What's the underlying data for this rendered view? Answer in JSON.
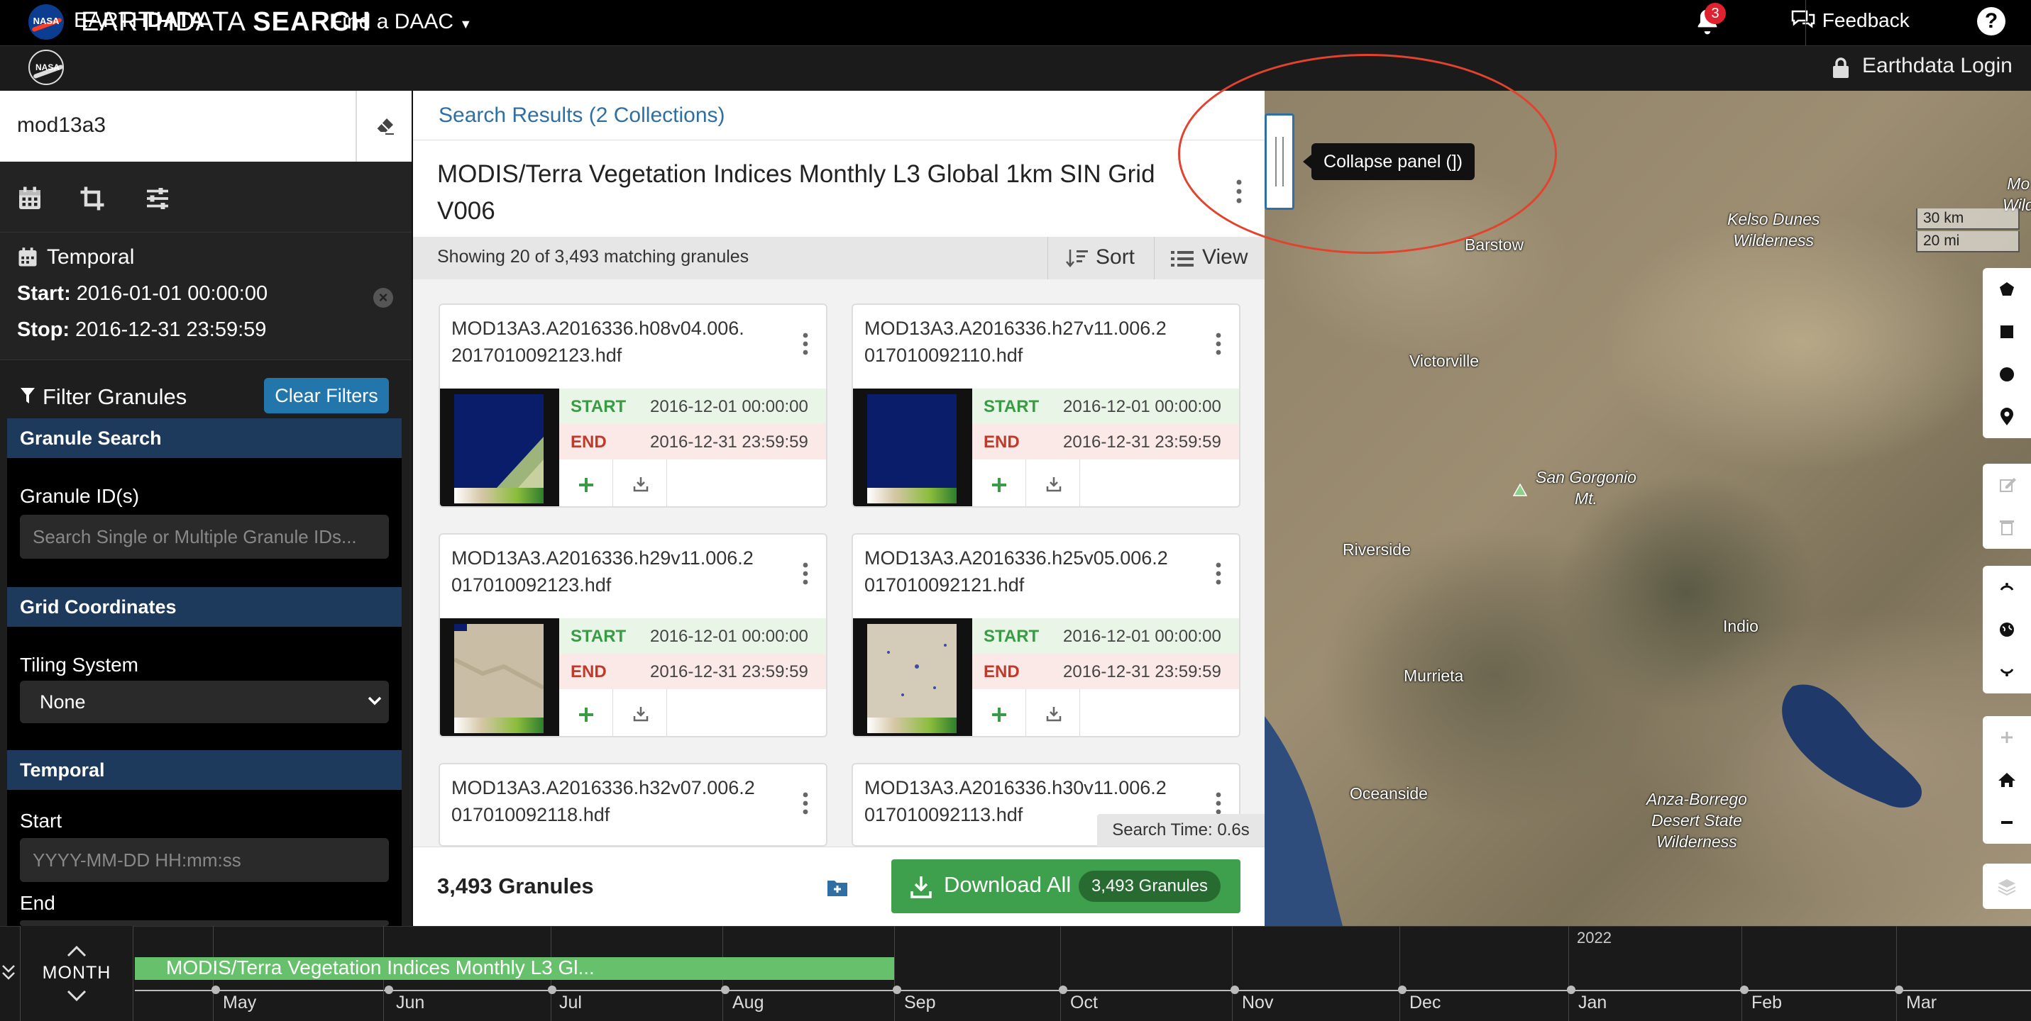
{
  "topbar": {
    "nasa_logo_text": "NASA",
    "brand_prefix": "EARTH",
    "brand_bold": "DATA",
    "find_daac": "Find a DAAC",
    "notification_count": "3",
    "feedback": "Feedback",
    "help": "?"
  },
  "secondbar": {
    "title_light": "EARTHDATA ",
    "title_bold": "SEARCH",
    "login": "Earthdata Login"
  },
  "sidebar": {
    "search_value": "mod13a3",
    "temporal": {
      "title": "Temporal",
      "start_label": "Start:",
      "start_value": "2016-01-01 00:00:00",
      "stop_label": "Stop:",
      "stop_value": "2016-12-31 23:59:59"
    },
    "filter": {
      "title": "Filter Granules",
      "clear_button": "Clear Filters",
      "sections": {
        "granule_search": "Granule Search",
        "grid_coordinates": "Grid Coordinates",
        "temporal": "Temporal"
      },
      "granule_id_label": "Granule ID(s)",
      "granule_id_placeholder": "Search Single or Multiple Granule IDs...",
      "tiling_label": "Tiling System",
      "tiling_value": "None",
      "start_label": "Start",
      "start_placeholder": "YYYY-MM-DD HH:mm:ss",
      "end_label": "End"
    }
  },
  "results": {
    "header": "Search Results (2 Collections)",
    "collection_title": "MODIS/Terra Vegetation Indices Monthly L3 Global 1km SIN Grid V006",
    "showing": "Showing 20 of 3,493 matching granules",
    "sort": "Sort",
    "view": "View",
    "start_label": "START",
    "end_label": "END",
    "granules": [
      {
        "name": "MOD13A3.A2016336.h08v04.006.\n2017010092123.hdf",
        "start": "2016-12-01 00:00:00",
        "end": "2016-12-31 23:59:59",
        "thumb": "ocean"
      },
      {
        "name": "MOD13A3.A2016336.h27v11.006.2\n017010092110.hdf",
        "start": "2016-12-01 00:00:00",
        "end": "2016-12-31 23:59:59",
        "thumb": "ocean-full"
      },
      {
        "name": "MOD13A3.A2016336.h29v11.006.2\n017010092123.hdf",
        "start": "2016-12-01 00:00:00",
        "end": "2016-12-31 23:59:59",
        "thumb": "land"
      },
      {
        "name": "MOD13A3.A2016336.h25v05.006.2\n017010092121.hdf",
        "start": "2016-12-01 00:00:00",
        "end": "2016-12-31 23:59:59",
        "thumb": "land-spots"
      },
      {
        "name": "MOD13A3.A2016336.h32v07.006.2\n017010092118.hdf"
      },
      {
        "name": "MOD13A3.A2016336.h30v11.006.2\n017010092113.hdf"
      }
    ],
    "search_time": "Search Time: 0.6s",
    "footer_count": "3,493 Granules",
    "download_all": "Download All",
    "download_pill": "3,493 Granules"
  },
  "tooltip": "Collapse panel (])",
  "map": {
    "labels": [
      "Barstow",
      "Victorville",
      "San Gorgonio\nMt.",
      "Riverside",
      "Indio",
      "Murrieta",
      "Oceanside",
      "Kelso Dunes\nWilderness",
      "Anza-Borrego\nDesert State\nWilderness",
      "Mo\nWild"
    ],
    "scale_km": "30 km",
    "scale_mi": "20 mi"
  },
  "timeline": {
    "zoom": "MONTH",
    "bar_label": "MODIS/Terra Vegetation Indices Monthly L3 Gl...",
    "year": "2022",
    "months": [
      "May",
      "Jun",
      "Jul",
      "Aug",
      "Sep",
      "Oct",
      "Nov",
      "Dec",
      "Jan",
      "Feb",
      "Mar"
    ]
  },
  "colors": {
    "accent_blue": "#2f6fa3",
    "download_green": "#3e9f4c",
    "start_green": "#3b9a46",
    "end_red": "#c0392b",
    "highlight_red": "#e2422e"
  }
}
